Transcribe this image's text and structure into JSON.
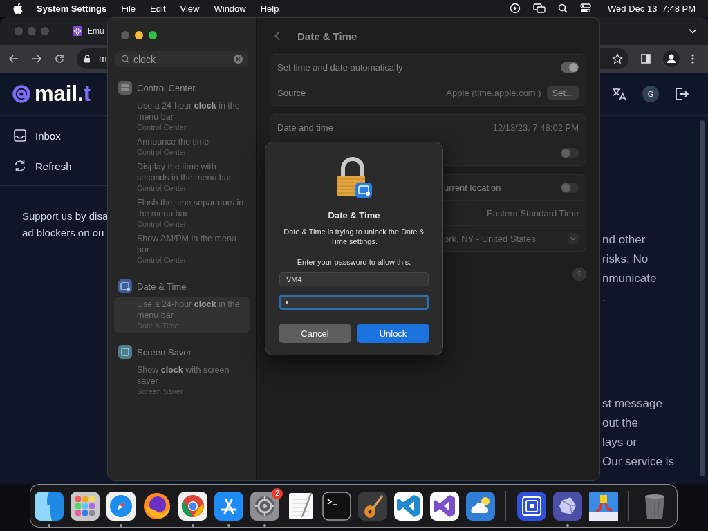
{
  "menu_bar": {
    "app_name": "System Settings",
    "menus": [
      "File",
      "Edit",
      "View",
      "Window",
      "Help"
    ],
    "clock": "Wed Dec 13  7:48 PM"
  },
  "browser": {
    "tab": {
      "title": "Emu"
    },
    "address": "m",
    "site": {
      "logo_main": "mail.",
      "logo_accent": "t",
      "nav": [
        {
          "kind": "inbox",
          "label": "Inbox"
        },
        {
          "kind": "refresh",
          "label": "Refresh"
        }
      ],
      "avatar": "G",
      "left_text": [
        "Support us by disa",
        "ad blockers on ou"
      ],
      "right_text": [
        [
          "nd other",
          "risks. No",
          "nmunicate",
          "."
        ],
        [
          "st message",
          "out the",
          "lays or",
          "Our service is"
        ]
      ]
    }
  },
  "settings": {
    "search": {
      "value": "clock"
    },
    "results": [
      {
        "title": "Control Center",
        "color": "#5b5b5b",
        "items": [
          {
            "text": "Use a 24-hour **clock** in the menu bar",
            "source": "Control Center",
            "selected": false
          },
          {
            "text": "Announce the time",
            "source": "Control Center",
            "selected": false
          },
          {
            "text": "Display the time with seconds in the menu bar",
            "source": "Control Center",
            "selected": false
          },
          {
            "text": "Flash the time separators in the menu bar",
            "source": "Control Center",
            "selected": false
          },
          {
            "text": "Show AM/PM in the menu bar",
            "source": "Control Center",
            "selected": false
          }
        ]
      },
      {
        "title": "Date & Time",
        "color": "#3e5f9a",
        "items": [
          {
            "text": "Use a 24-hour **clock** in the menu bar",
            "source": "Date & Time",
            "selected": true
          }
        ]
      },
      {
        "title": "Screen Saver",
        "color": "#4d7f8c",
        "items": [
          {
            "text": "Show **clock** with screen saver",
            "source": "Screen Saver",
            "selected": false
          }
        ]
      }
    ],
    "pane": {
      "title": "Date & Time",
      "help": "?",
      "groups": [
        {
          "rows": [
            {
              "kind": "toggle",
              "label": "Set time and date automatically",
              "on": true
            },
            {
              "kind": "button",
              "label": "Source",
              "value": "Apple (time.apple.com.)",
              "button": "Set..."
            }
          ]
        },
        {
          "rows": [
            {
              "kind": "value",
              "label": "Date and time",
              "value": "12/13/23, 7:48:02 PM"
            },
            {
              "kind": "toggle",
              "on": false
            }
          ]
        },
        {
          "rows": [
            {
              "kind": "toggle",
              "label": "urrent location",
              "on": false
            },
            {
              "kind": "value",
              "value": "Eastern Standard Time"
            },
            {
              "kind": "popup",
              "value": "ork, NY - United States"
            }
          ]
        }
      ]
    }
  },
  "dialog": {
    "title": "Date & Time",
    "message": "Date & Time is trying to unlock the Date & Time settings.",
    "prompt": "Enter your password to allow this.",
    "username": "VM4",
    "password": "•",
    "buttons": [
      {
        "kind": "secondary",
        "label": "Cancel"
      },
      {
        "kind": "primary",
        "label": "Unlock"
      }
    ]
  },
  "dock": {
    "sections": [
      {
        "items": [
          {
            "kind": "finder",
            "running": true
          },
          {
            "kind": "launchpad",
            "running": false
          },
          {
            "kind": "safari",
            "running": true
          },
          {
            "kind": "firefox",
            "running": false
          },
          {
            "kind": "chrome",
            "running": true
          },
          {
            "kind": "appstore",
            "running": true
          },
          {
            "kind": "settings",
            "running": true,
            "badge": "2"
          },
          {
            "kind": "textedit",
            "running": false
          },
          {
            "kind": "terminal",
            "running": false
          },
          {
            "kind": "garageband",
            "running": false
          },
          {
            "kind": "vscode",
            "running": false
          },
          {
            "kind": "visualstudio",
            "running": false
          },
          {
            "kind": "weather",
            "running": false
          }
        ]
      },
      {
        "items": [
          {
            "kind": "squares",
            "running": false
          },
          {
            "kind": "crystal",
            "running": true
          },
          {
            "kind": "game",
            "running": false
          }
        ]
      },
      {
        "items": [
          {
            "kind": "trash",
            "running": false
          }
        ]
      }
    ]
  }
}
